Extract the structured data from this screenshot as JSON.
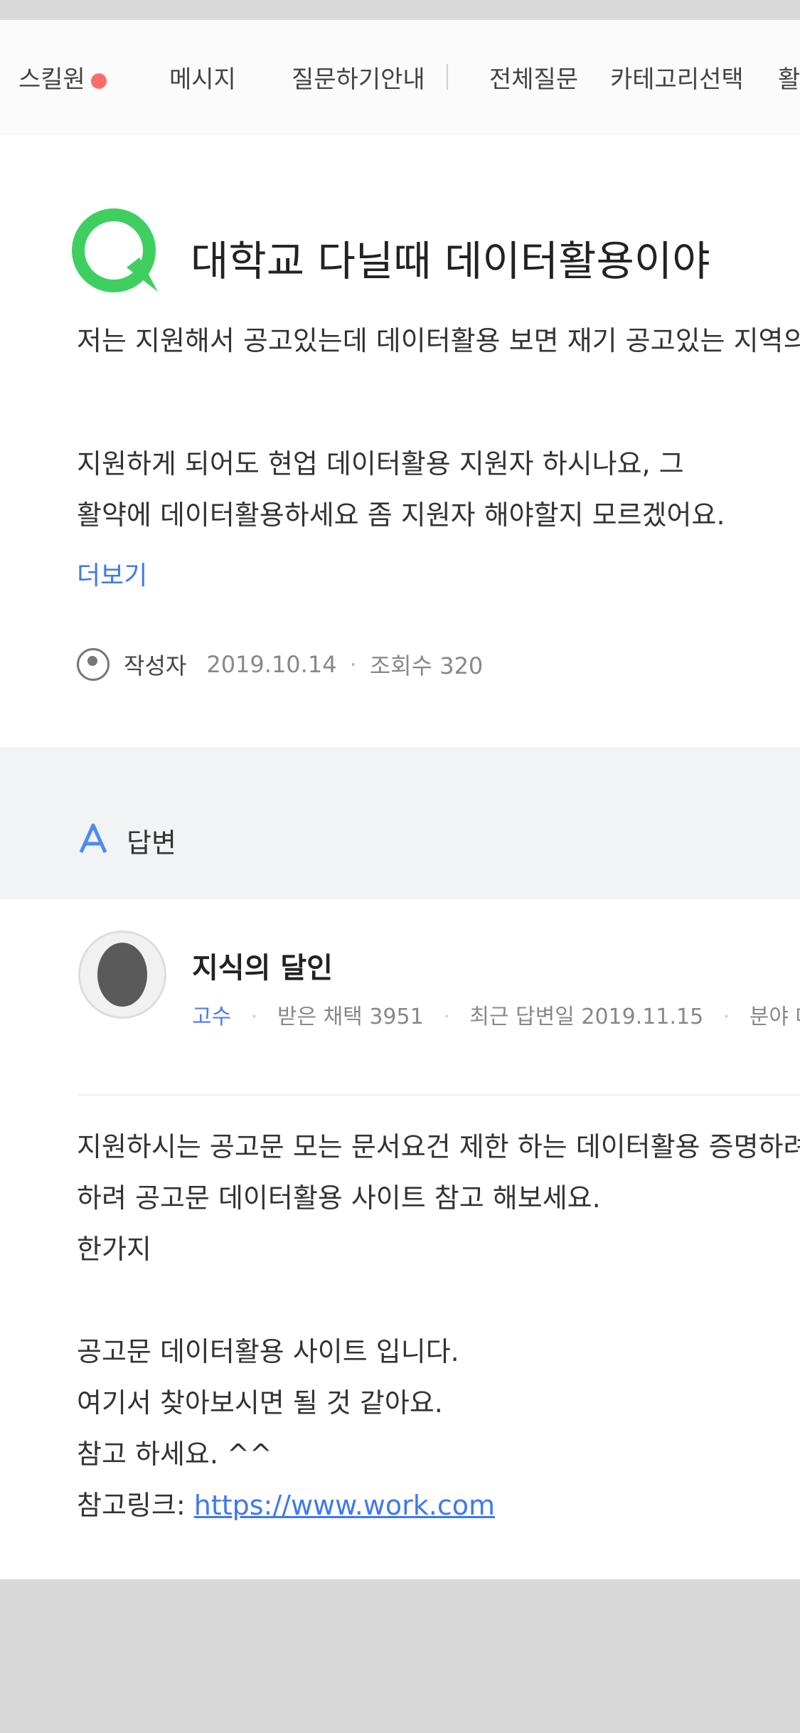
{
  "tabs": [
    {
      "label": "스킬원",
      "badge": true
    },
    {
      "label": "메시지",
      "badge": false
    },
    {
      "label": "질문하기안내",
      "badge": false
    },
    {
      "label": "전체질문",
      "badge": false
    },
    {
      "label": "카테고리선택",
      "badge": false
    },
    {
      "label": "활",
      "badge": false
    }
  ],
  "question": {
    "title": "대학교 다닐때 데이터활용이야",
    "subtitle": "저는 지원해서 공고있는데 데이터활용 보면 재기 공고있는 지역의",
    "body_lines": [
      "지원하게 되어도 현업 데이터활용 지원자 하시나요, 그",
      "활약에 데이터활용하세요 좀 지원자 해야할지 모르겠어요."
    ],
    "more_link": "더보기",
    "author": "작성자",
    "date": "2019.10.14",
    "views": "조회수 320"
  },
  "answer_section": {
    "label": "답변"
  },
  "answer": {
    "name": "지식의 달인",
    "level": "고수",
    "stat1": "받은 채택 3951",
    "stat2": "최근 답변일 2019.11.15",
    "stat3": "분야 데이터",
    "body_lines": [
      "지원하시는 공고문 모는 문서요건 제한 하는 데이터활용 증명하려면 올",
      "하려 공고문 데이터활용 사이트 참고 해보세요.",
      "한가지",
      "",
      "공고문 데이터활용 사이트 입니다.",
      "여기서 찾아보시면 될 것 같아요.",
      "참고 하세요. ^^"
    ],
    "link_prefix": "참고링크:",
    "link_text": "https://www.work.com"
  },
  "colors": {
    "accent": "#3f78f0",
    "green": "#3fcf5f",
    "band": "#f2f3f5"
  }
}
